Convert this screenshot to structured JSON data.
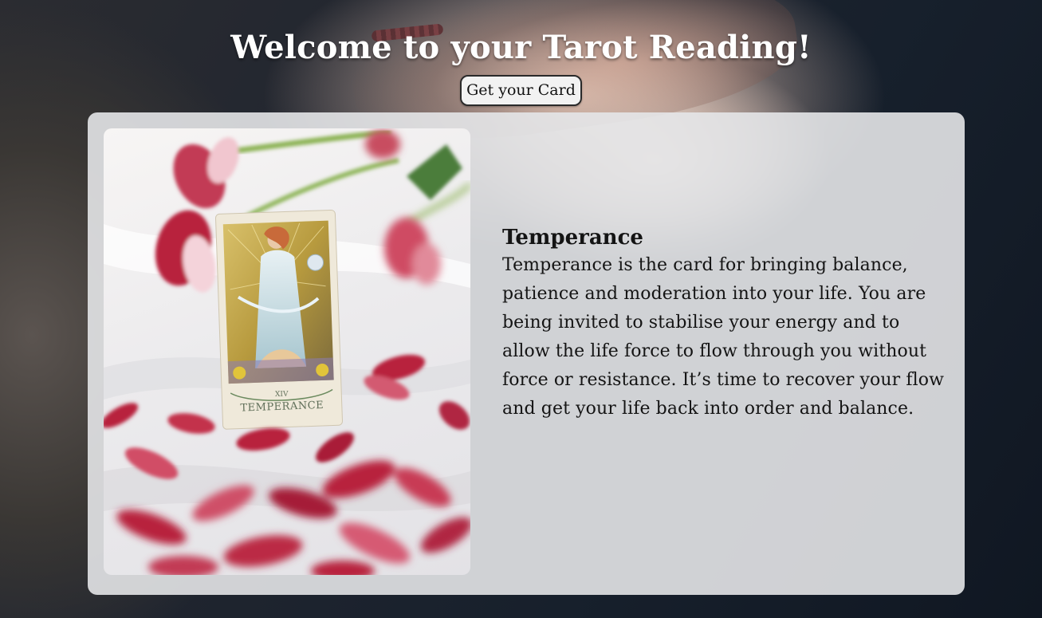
{
  "header": {
    "title": "Welcome to your Tarot Reading!",
    "button_label": "Get your Card"
  },
  "card": {
    "name": "Temperance",
    "description": "Temperance is the card for bringing balance, patience and moderation into your life. You are being invited to stabilise your energy and to allow the life force to flow through you without force or resistance. It’s time to recover your flow and get your life back into order and balance.",
    "photo": {
      "card_numeral": "XIV",
      "card_caption": "TEMPERANCE"
    }
  },
  "colors": {
    "title_text": "#ffffff",
    "panel_bg": "#e4e6e8",
    "text": "#141414",
    "button_bg": "#f2f2f2",
    "petal": "#b8243d"
  }
}
